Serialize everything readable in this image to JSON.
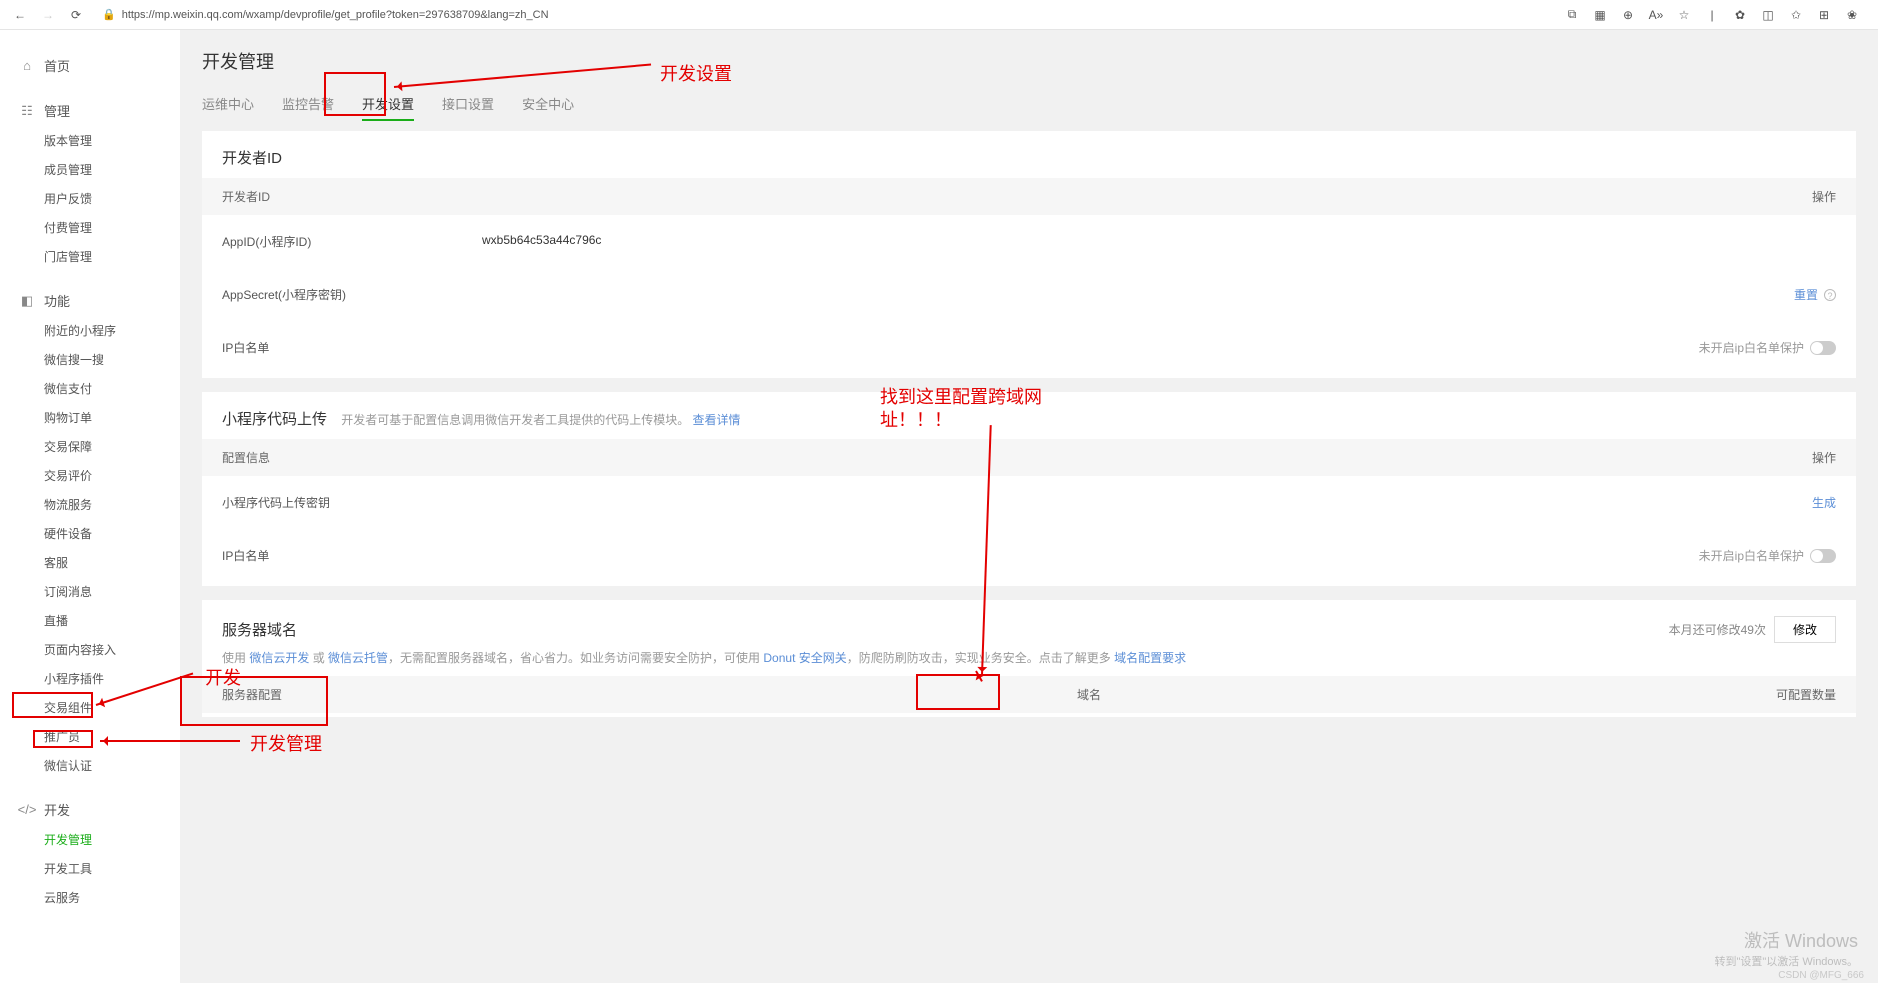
{
  "browser": {
    "url": "https://mp.weixin.qq.com/wxamp/devprofile/get_profile?token=297638709&lang=zh_CN"
  },
  "sidebar": {
    "home": "首页",
    "manage": {
      "label": "管理",
      "items": [
        "版本管理",
        "成员管理",
        "用户反馈",
        "付费管理",
        "门店管理"
      ]
    },
    "feature": {
      "label": "功能",
      "items": [
        "附近的小程序",
        "微信搜一搜",
        "微信支付",
        "购物订单",
        "交易保障",
        "交易评价",
        "物流服务",
        "硬件设备",
        "客服",
        "订阅消息",
        "直播",
        "页面内容接入",
        "小程序插件",
        "交易组件",
        "推广员",
        "微信认证"
      ]
    },
    "dev": {
      "label": "开发",
      "items": [
        "开发管理",
        "开发工具",
        "云服务"
      ]
    }
  },
  "page": {
    "title": "开发管理",
    "tabs": [
      "运维中心",
      "监控告警",
      "开发设置",
      "接口设置",
      "安全中心"
    ]
  },
  "card1": {
    "title": "开发者ID",
    "head_id": "开发者ID",
    "head_action": "操作",
    "rows": {
      "appid_label": "AppID(小程序ID)",
      "appid_value": "wxb5b64c53a44c796c",
      "secret_label": "AppSecret(小程序密钥)",
      "secret_action": "重置",
      "ipwhite_label": "IP白名单",
      "ipwhite_status": "未开启ip白名单保护"
    }
  },
  "card2": {
    "title": "小程序代码上传",
    "subtitle": "开发者可基于配置信息调用微信开发者工具提供的代码上传模块。",
    "subtitle_link": "查看详情",
    "head_config": "配置信息",
    "head_action": "操作",
    "rows": {
      "key_label": "小程序代码上传密钥",
      "key_action": "生成",
      "ipwhite_label": "IP白名单",
      "ipwhite_status": "未开启ip白名单保护"
    }
  },
  "card3": {
    "title": "服务器域名",
    "quota": "本月还可修改49次",
    "modify": "修改",
    "desc_prefix": "使用 ",
    "desc_link1": "微信云开发",
    "desc_or": " 或 ",
    "desc_link2": "微信云托管",
    "desc_mid1": "，无需配置服务器域名，省心省力。如业务访问需要安全防护，可使用 ",
    "desc_link3": "Donut 安全网关",
    "desc_mid2": "，防爬防刷防攻击，实现业务安全。点击了解更多 ",
    "desc_link4": "域名配置要求",
    "head_server": "服务器配置",
    "head_domain": "域名",
    "head_count": "可配置数量"
  },
  "anno": {
    "dev_settings": "开发设置",
    "cors_config": "找到这里配置跨域网址！！！",
    "dev": "开发",
    "dev_manage": "开发管理"
  },
  "watermark": {
    "line1": "激活 Windows",
    "line2": "转到\"设置\"以激活 Windows。",
    "csdn": "CSDN @MFG_666"
  }
}
